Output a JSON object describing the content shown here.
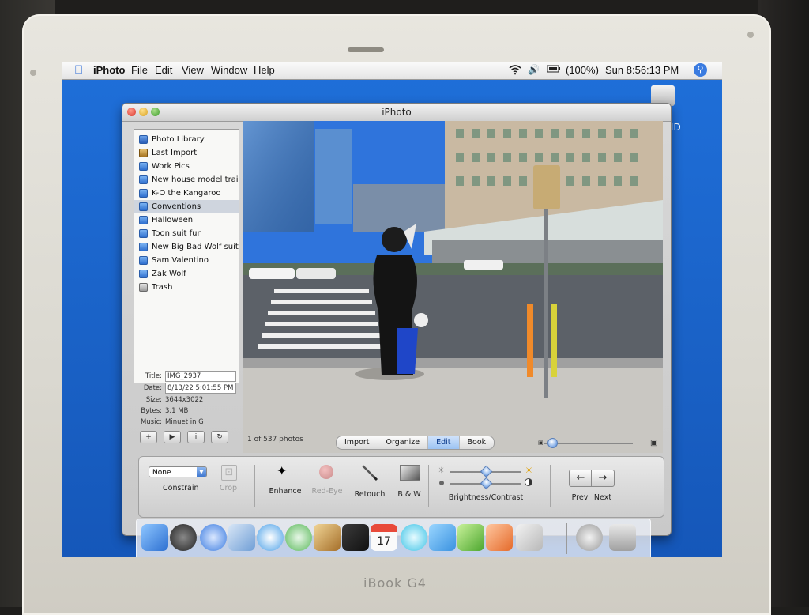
{
  "menubar": {
    "app_name": "iPhoto",
    "menus": [
      "File",
      "Edit",
      "View",
      "Window",
      "Help"
    ],
    "battery": "(100%)",
    "clock": "Sun 8:56:13 PM"
  },
  "desktop": {
    "disk_label": "h HD"
  },
  "window": {
    "title": "iPhoto",
    "sources": [
      {
        "label": "Photo Library",
        "icon": "photo-library-icon"
      },
      {
        "label": "Last Import",
        "icon": "last-import-icon"
      },
      {
        "label": "Work Pics",
        "icon": "album-icon"
      },
      {
        "label": "New house model trai",
        "icon": "album-icon"
      },
      {
        "label": "K-O the Kangaroo",
        "icon": "album-icon"
      },
      {
        "label": "Conventions",
        "icon": "album-icon",
        "selected": true
      },
      {
        "label": "Halloween",
        "icon": "album-icon"
      },
      {
        "label": "Toon suit fun",
        "icon": "album-icon"
      },
      {
        "label": "New Big Bad Wolf suit",
        "icon": "album-icon"
      },
      {
        "label": "Sam Valentino",
        "icon": "album-icon"
      },
      {
        "label": "Zak Wolf",
        "icon": "album-icon"
      },
      {
        "label": "Trash",
        "icon": "trash-icon"
      }
    ],
    "info": {
      "title_label": "Title:",
      "title_value": "IMG_2937",
      "date_label": "Date:",
      "date_value": "8/13/22 5:01:55 PM",
      "size_label": "Size:",
      "size_value": "3644x3022",
      "bytes_label": "Bytes:",
      "bytes_value": "3.1 MB",
      "music_label": "Music:",
      "music_value": "Minuet in G"
    },
    "photo_count": "1 of 537 photos",
    "modes": [
      "Import",
      "Organize",
      "Edit",
      "Book"
    ],
    "active_mode": "Edit",
    "edit_tools": {
      "constrain_value": "None",
      "constrain_label": "Constrain",
      "crop_label": "Crop",
      "enhance_label": "Enhance",
      "redeye_label": "Red-Eye",
      "retouch_label": "Retouch",
      "bw_label": "B & W",
      "brightness_label": "Brightness/Contrast",
      "prev_label": "Prev",
      "next_label": "Next"
    }
  },
  "bezel": {
    "model": "iBook G4"
  },
  "colors": {
    "desktop": "#1a62c7",
    "selection": "#cfd5de",
    "accent": "#3f77cf"
  }
}
